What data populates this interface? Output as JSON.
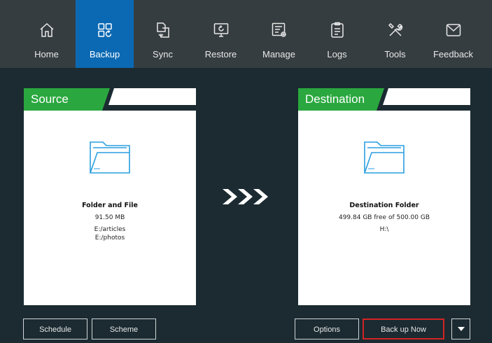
{
  "nav": {
    "items": [
      {
        "label": "Home",
        "icon": "home-icon"
      },
      {
        "label": "Backup",
        "icon": "backup-icon",
        "active": true
      },
      {
        "label": "Sync",
        "icon": "sync-icon"
      },
      {
        "label": "Restore",
        "icon": "restore-icon"
      },
      {
        "label": "Manage",
        "icon": "manage-icon"
      },
      {
        "label": "Logs",
        "icon": "logs-icon"
      },
      {
        "label": "Tools",
        "icon": "tools-icon"
      },
      {
        "label": "Feedback",
        "icon": "feedback-icon"
      }
    ]
  },
  "source": {
    "header": "Source",
    "title": "Folder and File",
    "size": "91.50 MB",
    "paths": [
      "E:/articles",
      "E:/photos"
    ]
  },
  "destination": {
    "header": "Destination",
    "title": "Destination Folder",
    "free": "499.84 GB free of 500.00 GB",
    "path": "H:\\"
  },
  "buttons": {
    "schedule": "Schedule",
    "scheme": "Scheme",
    "options": "Options",
    "backup_now": "Back up Now"
  },
  "colors": {
    "accent_active": "#0b69b3",
    "header_green": "#2aa83f",
    "highlight_red": "#d32424"
  }
}
